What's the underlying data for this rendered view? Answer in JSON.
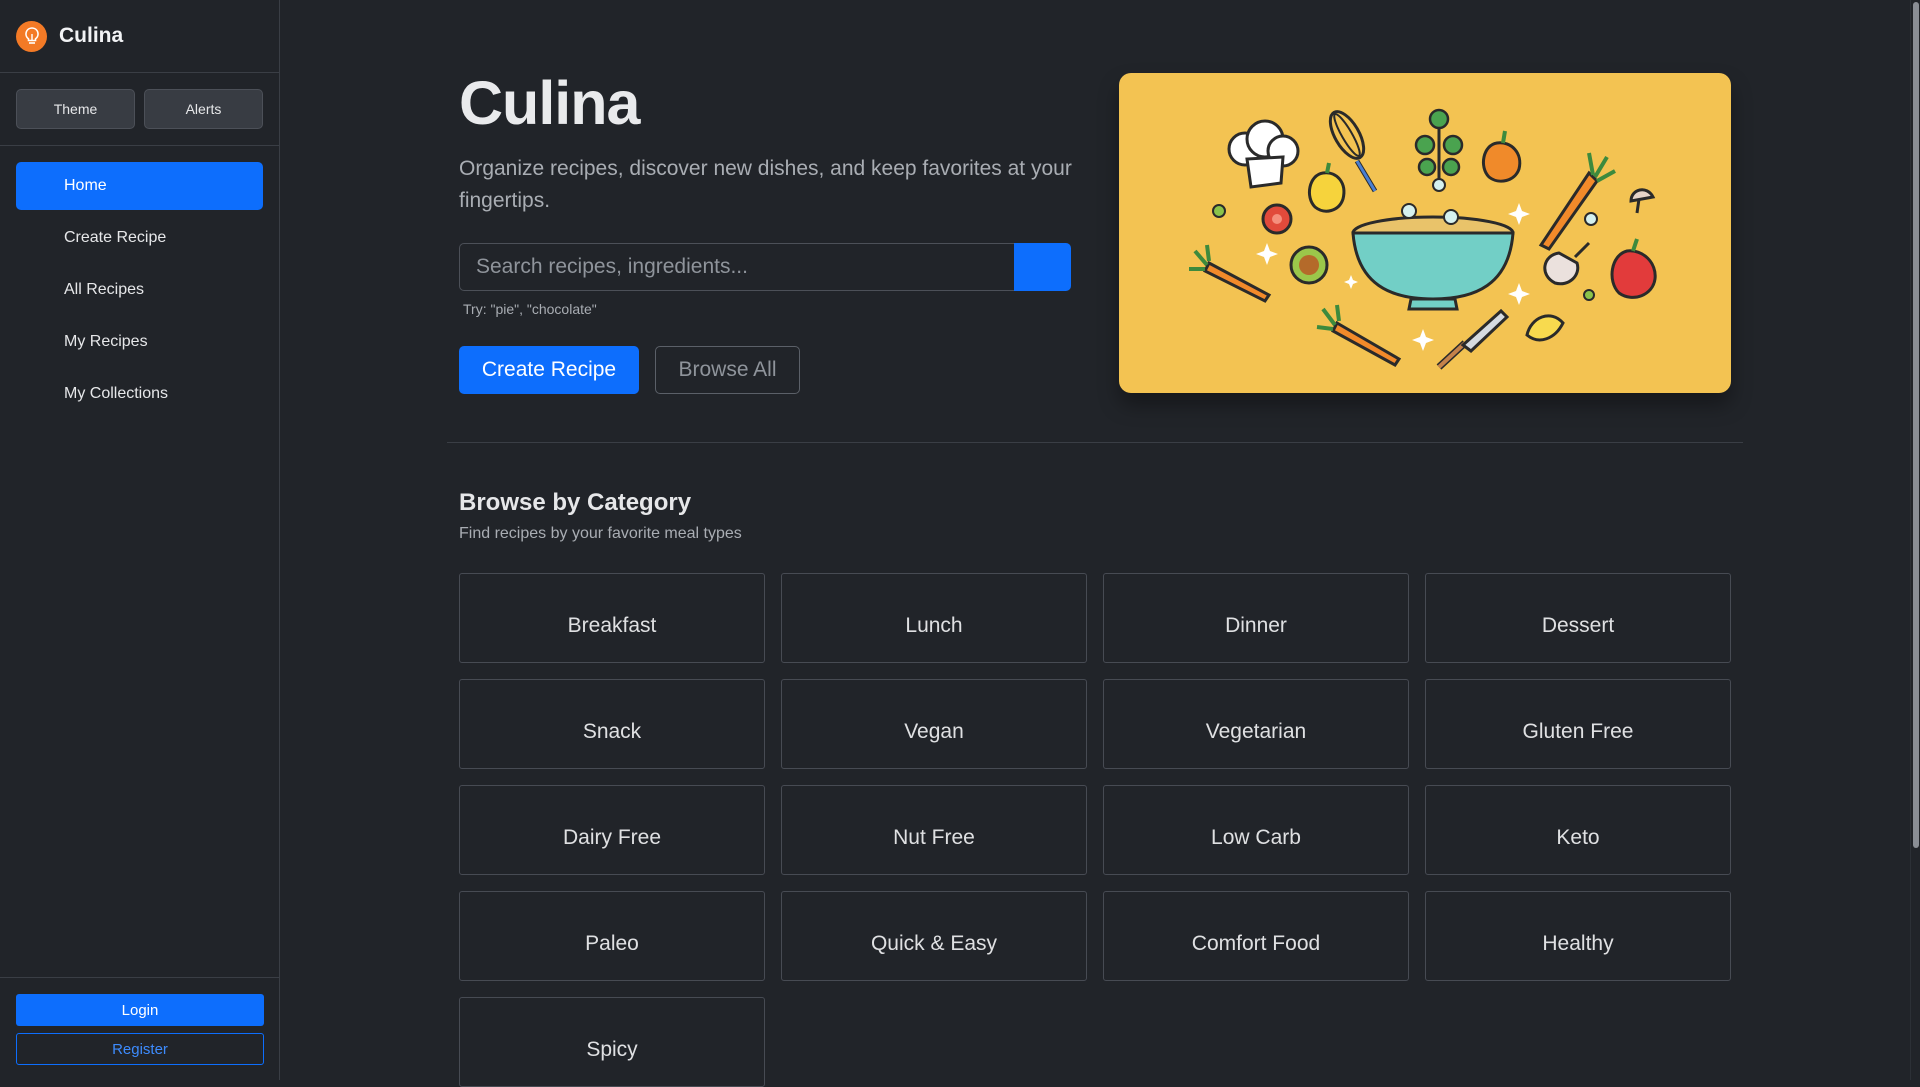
{
  "app": {
    "name": "Culina",
    "logo_icon": "lightbulb-icon",
    "accent_color": "#0d6efd",
    "logo_color": "#f37a26"
  },
  "sidebar": {
    "utility_buttons": {
      "theme": "Theme",
      "alerts": "Alerts"
    },
    "nav": [
      {
        "label": "Home",
        "active": true
      },
      {
        "label": "Create Recipe",
        "active": false
      },
      {
        "label": "All Recipes",
        "active": false
      },
      {
        "label": "My Recipes",
        "active": false
      },
      {
        "label": "My Collections",
        "active": false
      }
    ],
    "auth": {
      "login": "Login",
      "register": "Register"
    }
  },
  "hero": {
    "title": "Culina",
    "subtitle": "Organize recipes, discover new dishes, and keep favorites at your fingertips.",
    "search_placeholder": "Search recipes, ingredients...",
    "search_value": "",
    "search_hint": "Try: \"pie\", \"chocolate\"",
    "primary_cta": "Create Recipe",
    "secondary_cta": "Browse All",
    "illustration": "cooking-ingredients-illustration",
    "illustration_bg": "#f3c352"
  },
  "categories": {
    "title": "Browse by Category",
    "subtitle": "Find recipes by your favorite meal types",
    "items": [
      "Breakfast",
      "Lunch",
      "Dinner",
      "Dessert",
      "Snack",
      "Vegan",
      "Vegetarian",
      "Gluten Free",
      "Dairy Free",
      "Nut Free",
      "Low Carb",
      "Keto",
      "Paleo",
      "Quick & Easy",
      "Comfort Food",
      "Healthy",
      "Spicy"
    ]
  }
}
